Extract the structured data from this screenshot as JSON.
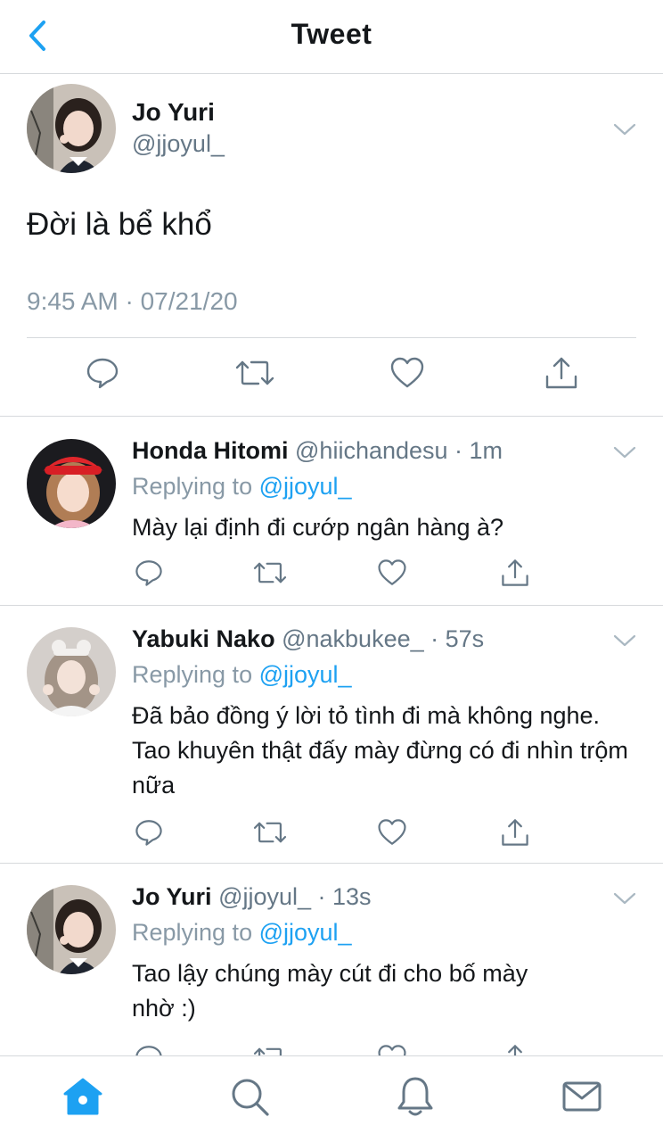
{
  "header": {
    "title": "Tweet"
  },
  "main_tweet": {
    "name": "Jo Yuri",
    "handle": "@jjoyul_",
    "text": "Đời là bể khổ",
    "timestamp": "9:45 AM · 07/21/20"
  },
  "replies": [
    {
      "name": "Honda Hitomi",
      "meta": "@hiichandesu · 1m",
      "replying_prefix": "Replying to ",
      "replying_to": "@jjoyul_",
      "text": "Mày lại định đi cướp ngân hàng à?"
    },
    {
      "name": "Yabuki Nako",
      "meta": "@nakbukee_ · 57s",
      "replying_prefix": "Replying to ",
      "replying_to": "@jjoyul_",
      "text": "Đã bảo đồng ý lời tỏ tình đi mà không nghe. Tao khuyên thật đấy mày đừng có đi nhìn trộm nữa"
    },
    {
      "name": "Jo Yuri",
      "meta": "@jjoyul_ · 13s",
      "replying_prefix": "Replying to ",
      "replying_to": "@jjoyul_",
      "text": "Tao lậy chúng mày cút đi cho bố mày nhờ :)"
    }
  ],
  "icons": {
    "back": "chevron-left-icon",
    "caret": "chevron-down-icon",
    "reply": "speech-bubble-icon",
    "retweet": "retweet-icon",
    "like": "heart-icon",
    "share": "share-icon",
    "tabs": [
      "home-icon",
      "search-icon",
      "notifications-icon",
      "messages-icon"
    ]
  },
  "colors": {
    "accent": "#1da1f2",
    "text": "#14171a",
    "secondary": "#657786",
    "icon": "#657786",
    "divider": "#d6d9dc"
  }
}
